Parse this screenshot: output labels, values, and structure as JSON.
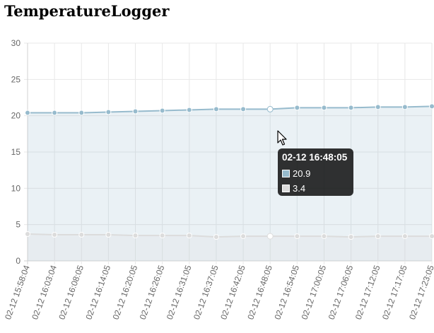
{
  "page": {
    "title": "TemperatureLogger"
  },
  "colors": {
    "series_1": "#97bbcd",
    "series_1_fill": "rgba(151,187,205,0.2)",
    "series_2": "#dcdcdc",
    "series_2_fill": "rgba(220,220,220,0.2)",
    "grid": "#e8e8e8",
    "axis": "#d0d0d0"
  },
  "tooltip": {
    "title": "02-12 16:48:05",
    "rows": [
      {
        "value": "20.9",
        "color": "#97bbcd"
      },
      {
        "value": "3.4",
        "color": "#dcdcdc"
      }
    ]
  },
  "cursor": {
    "icon": "mouse-pointer-icon"
  },
  "chart_data": {
    "type": "line",
    "title": "",
    "xlabel": "",
    "ylabel": "",
    "ylim": [
      0,
      30
    ],
    "yticks": [
      0,
      5,
      10,
      15,
      20,
      25,
      30
    ],
    "grid": true,
    "fill_area": true,
    "categories": [
      "02-12 15:58:04",
      "02-12 16:03:04",
      "02-12 16:08:05",
      "02-12 16:14:05",
      "02-12 16:20:05",
      "02-12 16:26:05",
      "02-12 16:31:05",
      "02-12 16:37:05",
      "02-12 16:42:05",
      "02-12 16:48:05",
      "02-12 16:54:05",
      "02-12 17:00:05",
      "02-12 17:06:05",
      "02-12 17:12:05",
      "02-12 17:17:05",
      "02-12 17:23:05"
    ],
    "series": [
      {
        "values": [
          20.4,
          20.4,
          20.4,
          20.5,
          20.6,
          20.7,
          20.8,
          20.9,
          20.9,
          20.9,
          21.1,
          21.1,
          21.1,
          21.2,
          21.2,
          21.3
        ]
      },
      {
        "values": [
          3.7,
          3.6,
          3.6,
          3.6,
          3.5,
          3.5,
          3.5,
          3.3,
          3.4,
          3.4,
          3.4,
          3.4,
          3.3,
          3.4,
          3.4,
          3.4
        ]
      }
    ],
    "highlighted_index": 9
  }
}
